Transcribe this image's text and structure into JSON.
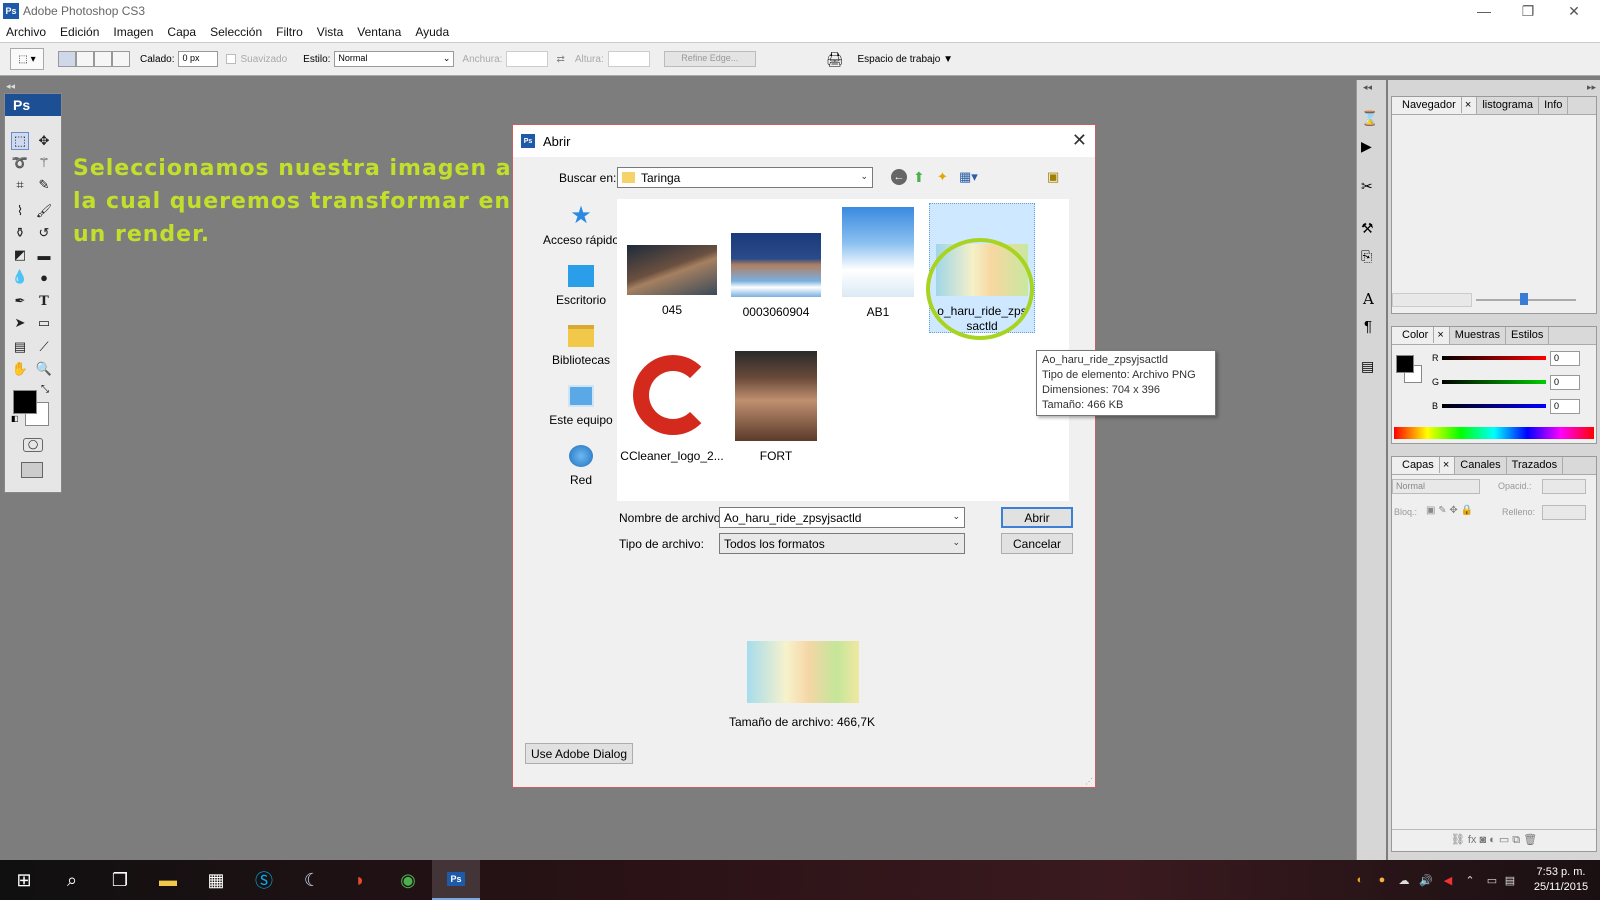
{
  "app": {
    "icon": "Ps",
    "title": "Adobe Photoshop CS3"
  },
  "menu": [
    "Archivo",
    "Edición",
    "Imagen",
    "Capa",
    "Selección",
    "Filtro",
    "Vista",
    "Ventana",
    "Ayuda"
  ],
  "options": {
    "calado_label": "Calado:",
    "calado_value": "0 px",
    "suavizado": "Suavizado",
    "estilo_label": "Estilo:",
    "estilo_value": "Normal",
    "anchura": "Anchura:",
    "altura": "Altura:",
    "refine": "Refine Edge...",
    "workspace": "Espacio de trabajo"
  },
  "instruction": "Seleccionamos nuestra imagen a la cual queremos transformar en un render.",
  "dialog": {
    "title": "Abrir",
    "buscar_label": "Buscar en:",
    "buscar_value": "Taringa",
    "places": [
      "Acceso rápido",
      "Escritorio",
      "Bibliotecas",
      "Este equipo",
      "Red"
    ],
    "files": [
      {
        "name": "045"
      },
      {
        "name": "0003060904"
      },
      {
        "name": "AB1"
      },
      {
        "name": "Ao_haru_ride_zpsyjsactld",
        "label_line1": "o_haru_ride_zps",
        "label_line2": "sactld"
      },
      {
        "name": "CCleaner_logo_2..."
      },
      {
        "name": "FORT"
      }
    ],
    "filename_label": "Nombre de archivo:",
    "filename_value": "Ao_haru_ride_zpsyjsactld",
    "filetype_label": "Tipo de archivo:",
    "filetype_value": "Todos los formatos",
    "open_btn": "Abrir",
    "cancel_btn": "Cancelar",
    "filesize": "Tamaño de archivo: 466,7K",
    "adobe_dialog_btn": "Use Adobe Dialog"
  },
  "tooltip": {
    "line1": "Ao_haru_ride_zpsyjsactld",
    "line2": "Tipo de elemento: Archivo PNG",
    "line3": "Dimensiones: 704 x 396",
    "line4": "Tamaño: 466 KB"
  },
  "panels": {
    "nav_tabs": [
      "Navegador",
      "listograma",
      "Info"
    ],
    "color_tabs": [
      "Color",
      "Muestras",
      "Estilos"
    ],
    "color_channels": [
      {
        "ch": "R",
        "value": "0"
      },
      {
        "ch": "G",
        "value": "0"
      },
      {
        "ch": "B",
        "value": "0"
      }
    ],
    "layer_tabs": [
      "Capas",
      "Canales",
      "Trazados"
    ],
    "blend_mode": "Normal",
    "opacity_label": "Opacid.:",
    "lock_label": "Bloq.:",
    "fill_label": "Relleno:"
  },
  "taskbar": {
    "time": "7:53 p. m.",
    "date": "25/11/2015",
    "active_app": "Ps"
  },
  "colors": {
    "accent": "#c2e02b",
    "ps_blue": "#1e5aa8",
    "dialog_border": "#c86060"
  }
}
